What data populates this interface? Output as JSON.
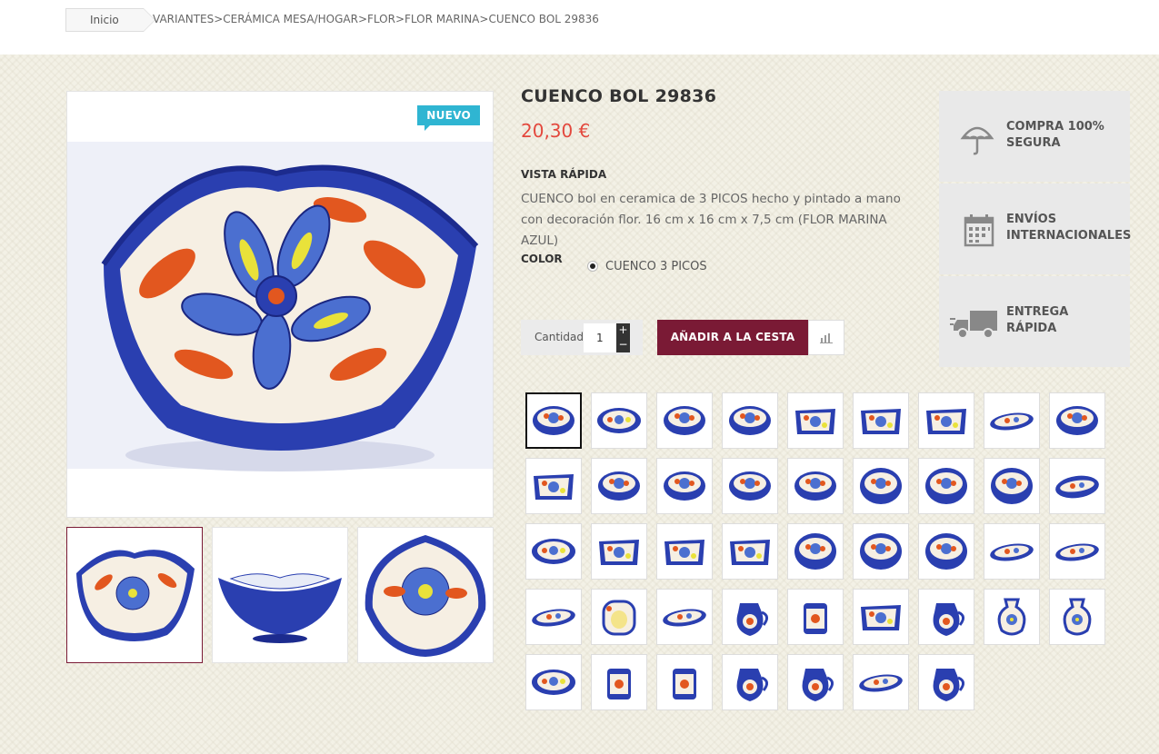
{
  "breadcrumb": {
    "home": "Inicio",
    "path": "VARIANTES>CERÁMICA MESA/HOGAR>FLOR>FLOR MARINA>CUENCO BOL 29836"
  },
  "product": {
    "badge": "NUEVO",
    "title": "CUENCO BOL 29836",
    "price": "20,30 €",
    "quick_view_label": "VISTA RÁPIDA",
    "description": "CUENCO bol en ceramica de 3 PICOS hecho y pintado a mano con decoración flor. 16 cm x 16 cm x 7,5 cm (FLOR MARINA AZUL)",
    "color_label": "COLOR",
    "color_option": "CUENCO 3 PICOS",
    "qty_label": "Cantidad",
    "qty_value": "1",
    "add_to_cart": "AÑADIR A LA CESTA"
  },
  "reassurance": [
    {
      "icon": "umbrella-icon",
      "line1": "COMPRA 100%",
      "line2": "SEGURA"
    },
    {
      "icon": "calendar-icon",
      "line1": "ENVÍOS",
      "line2": "INTERNACIONALES"
    },
    {
      "icon": "truck-icon",
      "line1": "ENTREGA",
      "line2": "RÁPIDA"
    }
  ],
  "colors": {
    "accent": "#7a1a35",
    "price": "#e3483d",
    "badge": "#2fb5d2",
    "ceramic_blue": "#2a3fb0",
    "ceramic_orange": "#e2571f"
  }
}
